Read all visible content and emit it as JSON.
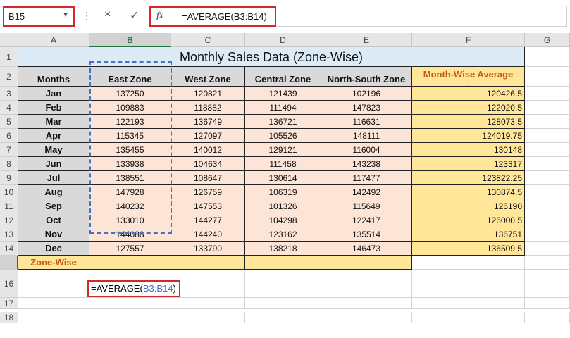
{
  "name_box": {
    "value": "B15"
  },
  "formula_bar": {
    "fx_label": "fx",
    "cancel_icon": "×",
    "enter_icon": "✓",
    "formula": "=AVERAGE(B3:B14)"
  },
  "columns": [
    "A",
    "B",
    "C",
    "D",
    "E",
    "F",
    "G"
  ],
  "rows": [
    "1",
    "2",
    "3",
    "4",
    "5",
    "6",
    "7",
    "8",
    "9",
    "10",
    "11",
    "12",
    "13",
    "14",
    "15",
    "16",
    "17",
    "18"
  ],
  "sheet": {
    "title": "Monthly Sales Data (Zone-Wise)",
    "headers": [
      "Months",
      "East Zone",
      "West Zone",
      "Central Zone",
      "North-South Zone",
      "Month-Wise Average Sales"
    ],
    "data": [
      [
        "Jan",
        "137250",
        "120821",
        "121439",
        "102196",
        "120426.5"
      ],
      [
        "Feb",
        "109883",
        "118882",
        "111494",
        "147823",
        "122020.5"
      ],
      [
        "Mar",
        "122193",
        "136749",
        "136721",
        "116631",
        "128073.5"
      ],
      [
        "Apr",
        "115345",
        "127097",
        "105526",
        "148111",
        "124019.75"
      ],
      [
        "May",
        "135455",
        "140012",
        "129121",
        "116004",
        "130148"
      ],
      [
        "Jun",
        "133938",
        "104634",
        "111458",
        "143238",
        "123317"
      ],
      [
        "Jul",
        "138551",
        "108647",
        "130614",
        "117477",
        "123822.25"
      ],
      [
        "Aug",
        "147928",
        "126759",
        "106319",
        "142492",
        "130874.5"
      ],
      [
        "Sep",
        "140232",
        "147553",
        "101326",
        "115649",
        "126190"
      ],
      [
        "Oct",
        "133010",
        "144277",
        "104298",
        "122417",
        "126000.5"
      ],
      [
        "Nov",
        "144088",
        "144240",
        "123162",
        "135514",
        "136751"
      ],
      [
        "Dec",
        "127557",
        "133790",
        "138218",
        "146473",
        "136509.5"
      ]
    ],
    "zone_label": "Zone-Wise Average Sales",
    "editing": {
      "prefix": "=AVERAGE(",
      "ref": "B3:B14",
      "suffix": ")"
    }
  },
  "colors": {
    "title_fill": "#ddebf7",
    "header_fill": "#d9d9d9",
    "data_fill": "#fce4d6",
    "average_fill": "#ffe699",
    "average_text": "#c65911",
    "highlight_red": "#d42828",
    "excel_green": "#217346"
  }
}
